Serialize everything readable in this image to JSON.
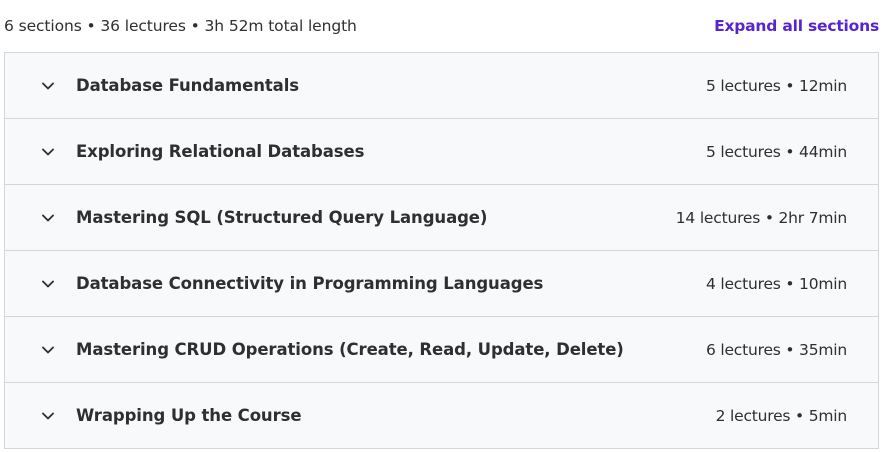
{
  "summary": {
    "text": "6 sections • 36 lectures • 3h 52m total length",
    "expand_label": "Expand all sections"
  },
  "colors": {
    "accent": "#5624d0",
    "section_bg": "#f7f9fa",
    "border": "#d1d7dc",
    "text": "#2d2f31"
  },
  "sections": [
    {
      "title": "Database Fundamentals",
      "meta": "5 lectures • 12min",
      "icon": "chevron-down-icon"
    },
    {
      "title": "Exploring Relational Databases",
      "meta": "5 lectures • 44min",
      "icon": "chevron-down-icon"
    },
    {
      "title": "Mastering SQL (Structured Query Language)",
      "meta": "14 lectures • 2hr 7min",
      "icon": "chevron-down-icon"
    },
    {
      "title": "Database Connectivity in Programming Languages",
      "meta": "4 lectures • 10min",
      "icon": "chevron-down-icon"
    },
    {
      "title": "Mastering CRUD Operations (Create, Read, Update, Delete)",
      "meta": "6 lectures • 35min",
      "icon": "chevron-down-icon"
    },
    {
      "title": "Wrapping Up the Course",
      "meta": "2 lectures • 5min",
      "icon": "chevron-down-icon"
    }
  ]
}
